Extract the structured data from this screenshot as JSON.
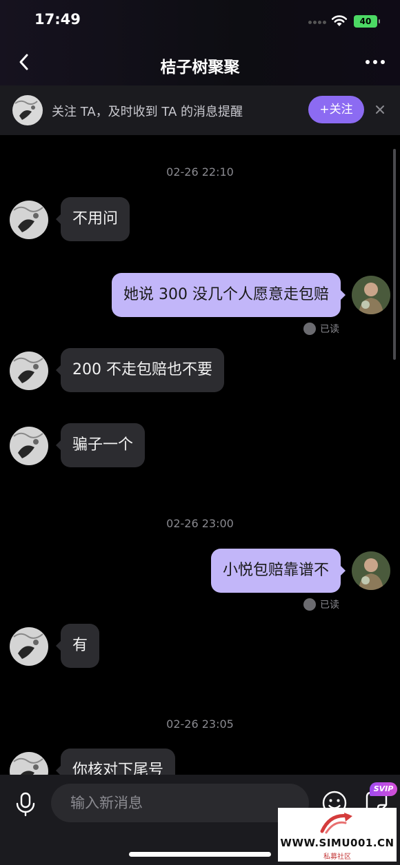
{
  "status_bar": {
    "time": "17:49",
    "battery": "40"
  },
  "header": {
    "title": "桔子树聚聚"
  },
  "follow_banner": {
    "text": "关注 TA，及时收到 TA 的消息提醒",
    "button_label": "+关注"
  },
  "messages": [
    {
      "type": "timestamp",
      "text": "02-26  22:10"
    },
    {
      "type": "incoming",
      "text": "不用问"
    },
    {
      "type": "outgoing",
      "text": "她说 300 没几个人愿意走包赔",
      "read_label": "已读"
    },
    {
      "type": "incoming",
      "text": "200 不走包赔也不要"
    },
    {
      "type": "incoming",
      "text": "骗子一个"
    },
    {
      "type": "timestamp",
      "text": "02-26  23:00"
    },
    {
      "type": "outgoing",
      "text": "小悦包赔靠谱不",
      "read_label": "已读"
    },
    {
      "type": "incoming",
      "text": "有"
    },
    {
      "type": "timestamp",
      "text": "02-26  23:05"
    },
    {
      "type": "incoming",
      "text": "你核对下尾号"
    }
  ],
  "input_bar": {
    "placeholder": "输入新消息",
    "svip_badge": "SVIP"
  },
  "watermark": {
    "url": "WWW.SIMU001.CN",
    "label": "私募社区"
  },
  "colors": {
    "accent": "#8c6bf2",
    "outgoing_bubble": "#c2b6f9",
    "incoming_bubble": "#2c2c30"
  }
}
